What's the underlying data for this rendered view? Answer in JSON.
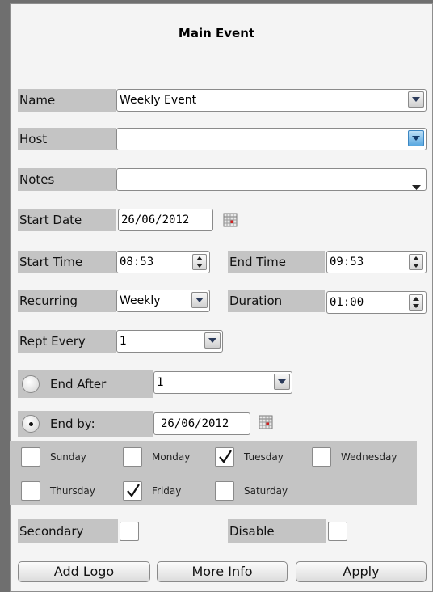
{
  "title": "Main Event",
  "fields": {
    "name_label": "Name",
    "name_value": "Weekly Event",
    "host_label": "Host",
    "host_value": "",
    "notes_label": "Notes",
    "notes_value": "",
    "start_date_label": "Start Date",
    "start_date_value": "26/06/2012",
    "start_time_label": "Start Time",
    "start_time_value": "08:53",
    "end_time_label": "End Time",
    "end_time_value": "09:53",
    "recurring_label": "Recurring",
    "recurring_value": "Weekly",
    "duration_label": "Duration",
    "duration_value": "01:00",
    "rept_every_label": "Rept Every",
    "rept_every_value": "1"
  },
  "end_options": {
    "end_after_label": "End After",
    "end_after_value": "1",
    "end_after_selected": false,
    "end_by_label": "End by:",
    "end_by_value": "26/06/2012",
    "end_by_selected": true
  },
  "days": [
    {
      "label": "Sunday",
      "checked": false
    },
    {
      "label": "Monday",
      "checked": false
    },
    {
      "label": "Tuesday",
      "checked": true
    },
    {
      "label": "Wednesday",
      "checked": false
    },
    {
      "label": "Thursday",
      "checked": false
    },
    {
      "label": "Friday",
      "checked": true
    },
    {
      "label": "Saturday",
      "checked": false
    }
  ],
  "flags": {
    "secondary_label": "Secondary",
    "secondary_checked": false,
    "disable_label": "Disable",
    "disable_checked": false
  },
  "buttons": {
    "add_logo": "Add Logo",
    "more_info": "More Info",
    "apply": "Apply"
  },
  "colors": {
    "label_band": "#c4c4c4",
    "panel": "#f4f4f4",
    "dropdown_blue": "#58a7e0",
    "calendar_red": "#d21f1f"
  }
}
